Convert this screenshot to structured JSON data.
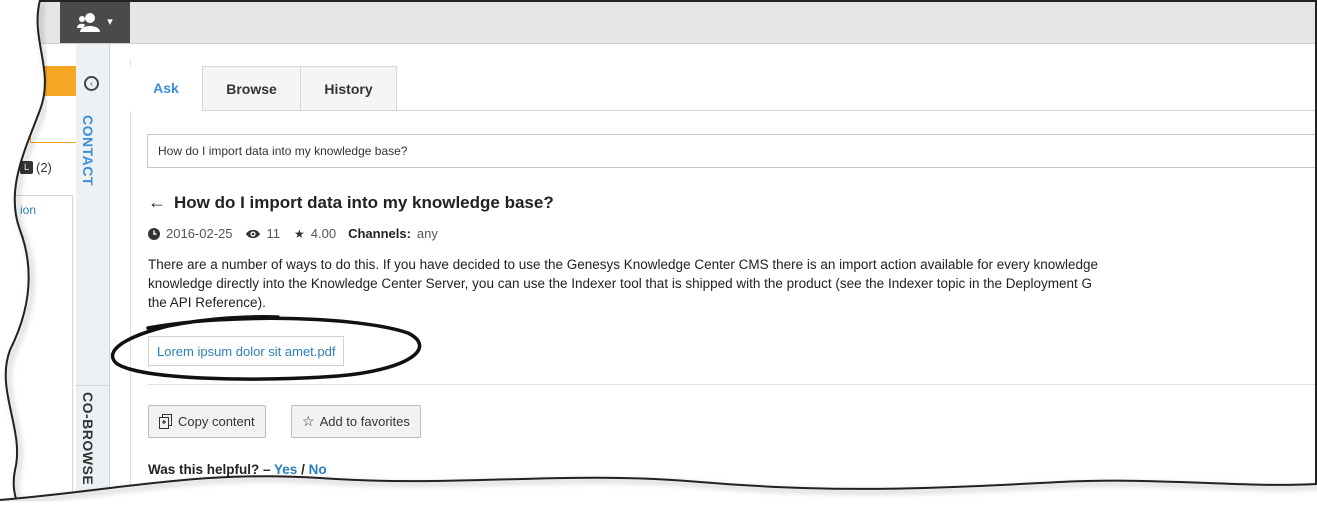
{
  "toolbar": {
    "agent_icon": "agent-status-icon",
    "agent_caret": "▾"
  },
  "left_panel": {
    "badge_count": "(2)",
    "badge_icon": "L",
    "link_fragment": "ion"
  },
  "side_rail": {
    "collapse_icon": "chevron-left-circle-icon",
    "contact_label": "CONTACT",
    "cobrowse_label": "CO-BROWSE"
  },
  "tabs": [
    {
      "label": "Ask",
      "active": true
    },
    {
      "label": "Browse",
      "active": false
    },
    {
      "label": "History",
      "active": false
    }
  ],
  "search": {
    "value": "How do I import data into my knowledge base?"
  },
  "article": {
    "back_icon": "←",
    "title": "How do I import data into my knowledge base?",
    "date": "2016-02-25",
    "views": "11",
    "rating": "4.00",
    "channels_label": "Channels:",
    "channels_value": "any",
    "lines": [
      "There are a number of ways to do this. If you have decided to use the Genesys Knowledge Center CMS there is an import action available for every knowledge",
      "knowledge directly into the Knowledge Center Server, you can use the Indexer tool that is shipped with the product (see the Indexer topic in the Deployment G",
      "the API Reference)."
    ],
    "attachment": "Lorem ipsum dolor sit amet.pdf"
  },
  "actions": {
    "copy": "Copy content",
    "favorite": "Add to favorites"
  },
  "feedback": {
    "question": "Was this helpful? –",
    "yes": "Yes",
    "separator": " / ",
    "no": "No"
  },
  "colors": {
    "accent": "#3a8fd6",
    "link": "#2b7fb8",
    "orange": "#f5a623",
    "dark": "#4a4a4a"
  }
}
